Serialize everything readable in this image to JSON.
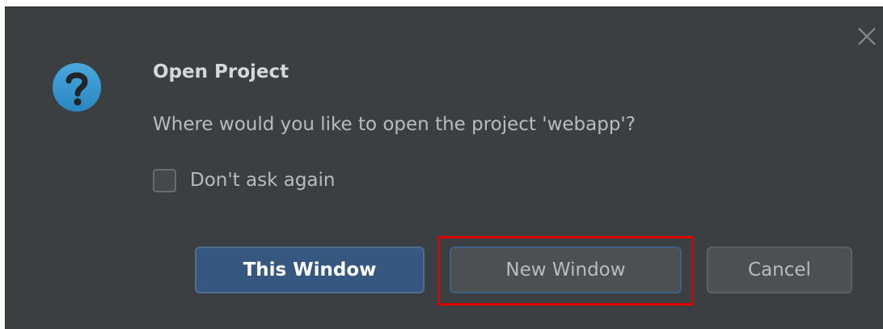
{
  "dialog": {
    "title": "Open Project",
    "message": "Where would you like to open the project 'webapp'?",
    "checkbox": {
      "label": "Don't ask again",
      "checked": false
    },
    "buttons": {
      "this_window": "This Window",
      "new_window": "New Window",
      "cancel": "Cancel"
    },
    "icons": {
      "main": "question-icon",
      "close": "close-icon"
    }
  },
  "colors": {
    "background": "#3c3f41",
    "primary_button": "#365880",
    "secondary_button": "#4c5052",
    "icon_blue": "#3592c4",
    "highlight": "#e00000",
    "text": "#bbbbbb"
  }
}
